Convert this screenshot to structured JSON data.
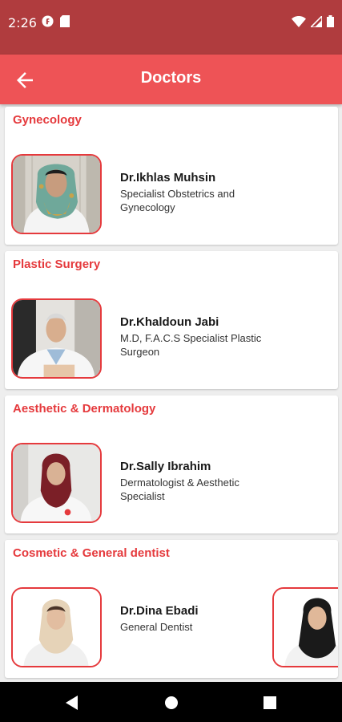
{
  "status_bar": {
    "time": "2:26",
    "left_icons": [
      "f-notification-icon",
      "sd-card-icon"
    ],
    "right_icons": [
      "wifi-icon",
      "signal-icon",
      "battery-icon"
    ]
  },
  "app_bar": {
    "title": "Doctors",
    "back_icon": "arrow-back-icon"
  },
  "sections": [
    {
      "title": "Gynecology",
      "doctors": [
        {
          "name": "Dr.Ikhlas Muhsin",
          "specialty": "Specialist Obstetrics and Gynecology"
        }
      ]
    },
    {
      "title": "Plastic Surgery",
      "doctors": [
        {
          "name": "Dr.Khaldoun Jabi",
          "specialty": "M.D, F.A.C.S Specialist Plastic Surgeon"
        }
      ]
    },
    {
      "title": "Aesthetic & Dermatology",
      "doctors": [
        {
          "name": "Dr.Sally Ibrahim",
          "specialty": "Dermatologist & Aesthetic Specialist"
        }
      ]
    },
    {
      "title": "Cosmetic & General dentist",
      "doctors": [
        {
          "name": "Dr.Dina Ebadi",
          "specialty": "General Dentist"
        },
        {
          "name": "",
          "specialty": ""
        }
      ]
    }
  ],
  "nav_bar": {
    "icons": [
      "back-triangle-icon",
      "home-circle-icon",
      "recents-square-icon"
    ]
  },
  "colors": {
    "status_bar": "#b03c3e",
    "app_bar": "#ee5356",
    "accent": "#e53a3d",
    "background": "#eeeeee"
  }
}
